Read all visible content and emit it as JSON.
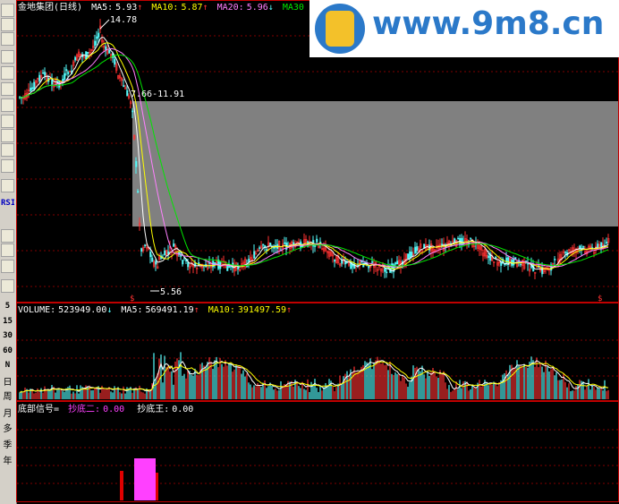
{
  "header": {
    "name": "金地集团",
    "period": "(日线)",
    "ma5_label": "MA5:",
    "ma5_val": "5.93",
    "ma5_dir": "↑",
    "ma10_label": "MA10:",
    "ma10_val": "5.87",
    "ma10_dir": "↑",
    "ma20_label": "MA20:",
    "ma20_val": "5.96",
    "ma20_dir": "↓",
    "ma30_label": "MA30"
  },
  "annotations": {
    "high": "14.78",
    "range": "7.66-11.91",
    "low": "5.56"
  },
  "volume_header": {
    "label": "VOLUME:",
    "val": "523949.00",
    "dir": "↓",
    "ma5_label": "MA5:",
    "ma5_val": "569491.19",
    "ma5_dir": "↑",
    "ma10_label": "MA10:",
    "ma10_val": "391497.59",
    "ma10_dir": "↑"
  },
  "indicator_header": {
    "label": "底部信号=",
    "s2_label": "抄底二:",
    "s2_val": "0.00",
    "king_label": "抄底王:",
    "king_val": "0.00"
  },
  "sidebar_labels": [
    "RSI",
    "5",
    "15",
    "30",
    "60",
    "N",
    "日",
    "周",
    "月",
    "多",
    "季",
    "年"
  ],
  "watermark": {
    "text": "www.9m8.cn"
  },
  "colors": {
    "up": "#ff3232",
    "down": "#54fcfc",
    "ma5": "#ffffff",
    "ma10": "#ffff00",
    "ma20": "#ff80ff",
    "ma30": "#00e600",
    "box": "#808080",
    "signal": "#ff40ff"
  },
  "chart_data": {
    "type": "candlestick",
    "series": [
      {
        "name": "MA5",
        "values": [
          5.93
        ]
      },
      {
        "name": "MA10",
        "values": [
          5.87
        ]
      },
      {
        "name": "MA20",
        "values": [
          5.96
        ]
      }
    ],
    "price_points": {
      "high": 14.78,
      "low": 5.56,
      "range_low": 7.66,
      "range_high": 11.91
    },
    "volume": {
      "value": 523949.0,
      "ma5": 569491.19,
      "ma10": 391497.59
    },
    "indicator": {
      "抄底二": 0.0,
      "抄底王": 0.0
    }
  }
}
